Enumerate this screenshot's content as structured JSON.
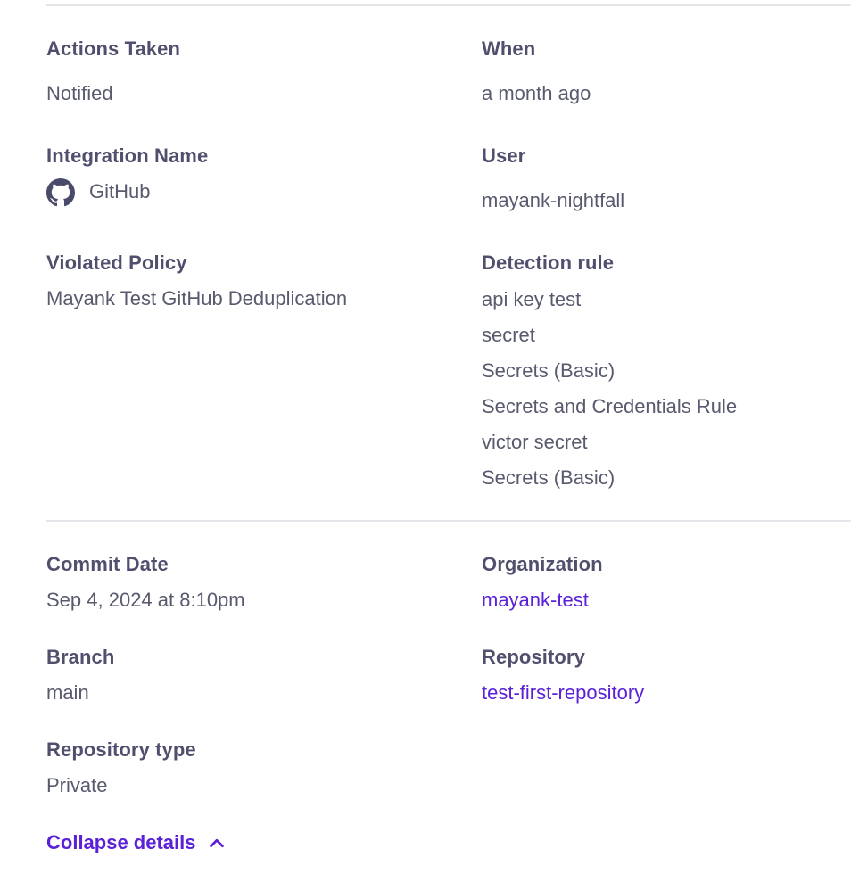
{
  "details": {
    "actions_taken": {
      "label": "Actions Taken",
      "value": "Notified"
    },
    "when": {
      "label": "When",
      "value": "a month ago"
    },
    "integration": {
      "label": "Integration Name",
      "value": "GitHub",
      "icon": "github-icon"
    },
    "user": {
      "label": "User",
      "value": "mayank-nightfall"
    },
    "violated_policy": {
      "label": "Violated Policy",
      "value": "Mayank Test GitHub Deduplication"
    },
    "detection_rule": {
      "label": "Detection rule",
      "rules": [
        "api key test",
        "secret",
        "Secrets (Basic)",
        "Secrets and Credentials Rule",
        "victor secret",
        "Secrets (Basic)"
      ]
    }
  },
  "commit": {
    "commit_date": {
      "label": "Commit Date",
      "value": "Sep 4, 2024 at 8:10pm"
    },
    "organization": {
      "label": "Organization",
      "value": "mayank-test"
    },
    "branch": {
      "label": "Branch",
      "value": "main"
    },
    "repository": {
      "label": "Repository",
      "value": "test-first-repository"
    },
    "repository_type": {
      "label": "Repository type",
      "value": "Private"
    }
  },
  "footer": {
    "collapse_label": "Collapse details",
    "icon": "chevron-up-icon"
  },
  "colors": {
    "label": "#50506e",
    "value": "#585a6e",
    "accent": "#5b21d6",
    "divider": "#e6e6ea"
  }
}
